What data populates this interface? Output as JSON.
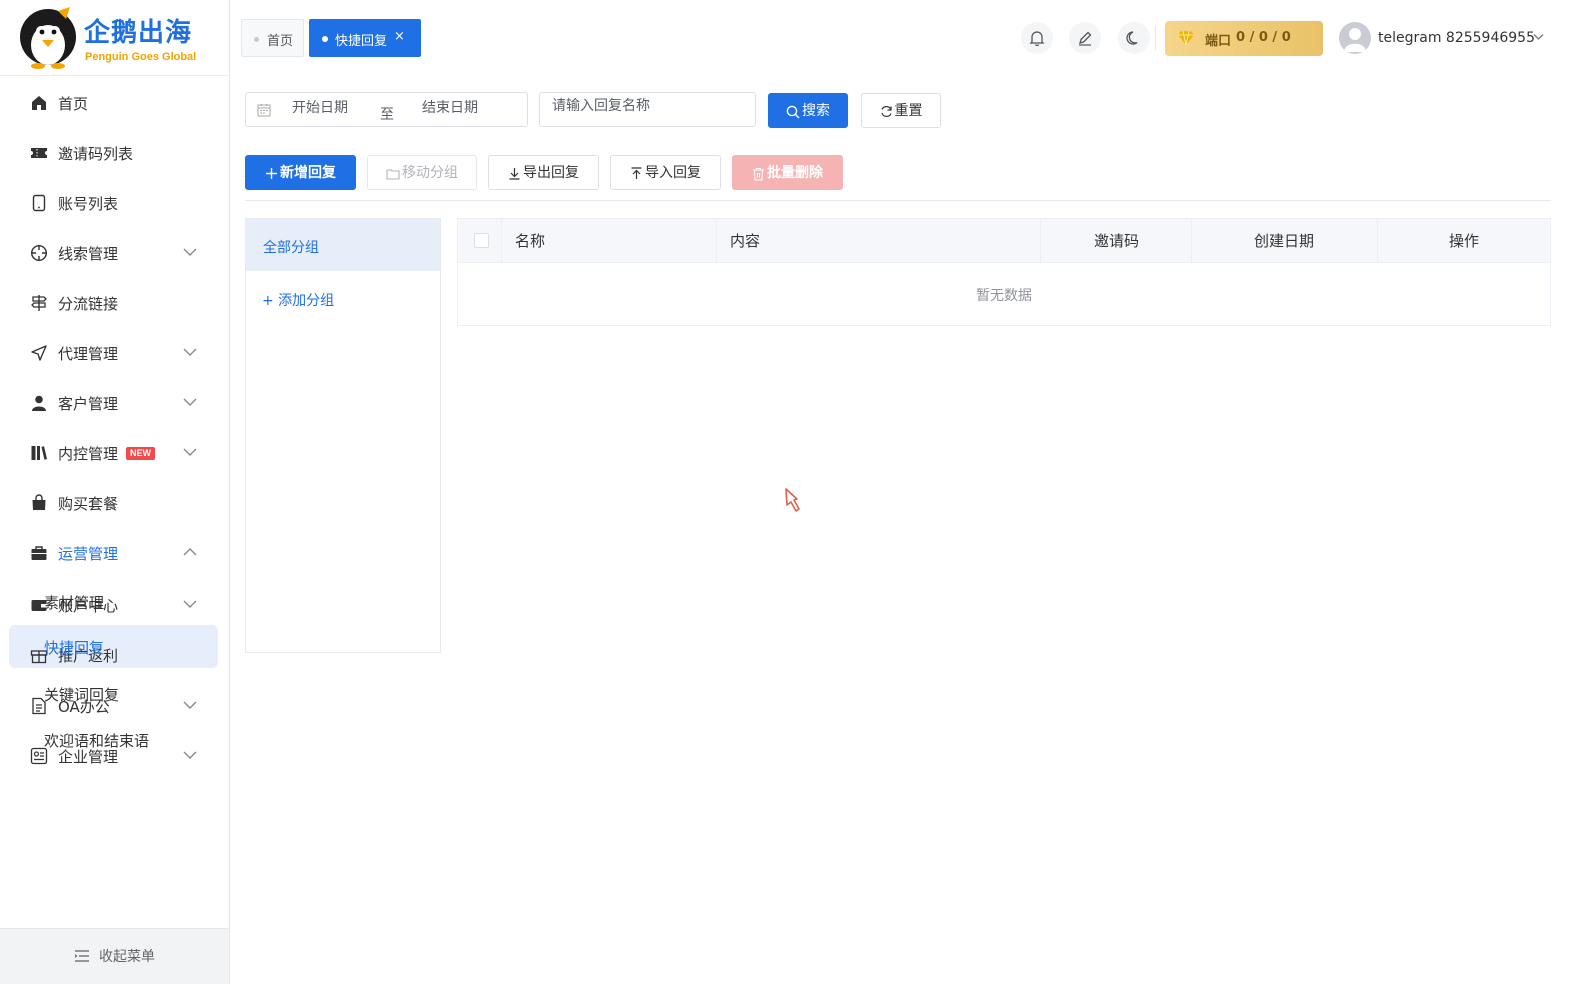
{
  "brand": {
    "title": "企鹅出海",
    "subtitle": "Penguin Goes Global"
  },
  "sidebar": {
    "items": [
      {
        "label": "首页",
        "icon": "home-icon"
      },
      {
        "label": "邀请码列表",
        "icon": "ticket-icon"
      },
      {
        "label": "账号列表",
        "icon": "phone-icon"
      },
      {
        "label": "线索管理",
        "icon": "compass-icon"
      },
      {
        "label": "分流链接",
        "icon": "signpost-icon"
      },
      {
        "label": "代理管理",
        "icon": "send-icon"
      },
      {
        "label": "客户管理",
        "icon": "user-icon"
      },
      {
        "label": "内控管理",
        "icon": "books-icon",
        "badge": "NEW"
      },
      {
        "label": "购买套餐",
        "icon": "bag-icon"
      },
      {
        "label": "运营管理",
        "icon": "briefcase-icon"
      },
      {
        "label": "账户中心",
        "icon": "wallet-icon"
      },
      {
        "label": "推广返利",
        "icon": "gift-icon"
      },
      {
        "label": "OA办公",
        "icon": "document-icon"
      },
      {
        "label": "企业管理",
        "icon": "enterprise-icon"
      }
    ],
    "submenu": [
      "素材管理",
      "快捷回复",
      "关键词回复",
      "欢迎语和结束语"
    ],
    "collapse_label": "收起菜单"
  },
  "tabs": {
    "home": "首页",
    "current": "快捷回复",
    "close": "×"
  },
  "header": {
    "port_label": "端口",
    "port_value": "0 / 0 / 0",
    "user": "telegram  8255946955",
    "accent": "#1f6fe5"
  },
  "filters": {
    "start_placeholder": "开始日期",
    "range_separator": "至",
    "end_placeholder": "结束日期",
    "name_placeholder": "请输入回复名称",
    "search_label": "搜索",
    "reset_label": "重置"
  },
  "toolbar": {
    "add_label": "新增回复",
    "move_label": "移动分组",
    "export_label": "导出回复",
    "import_label": "导入回复",
    "batch_delete_label": "批量删除"
  },
  "groups": {
    "all": "全部分组",
    "add": "+ 添加分组"
  },
  "table": {
    "columns": [
      "名称",
      "内容",
      "邀请码",
      "创建日期",
      "操作"
    ],
    "rows": [],
    "empty_text": "暂无数据"
  }
}
